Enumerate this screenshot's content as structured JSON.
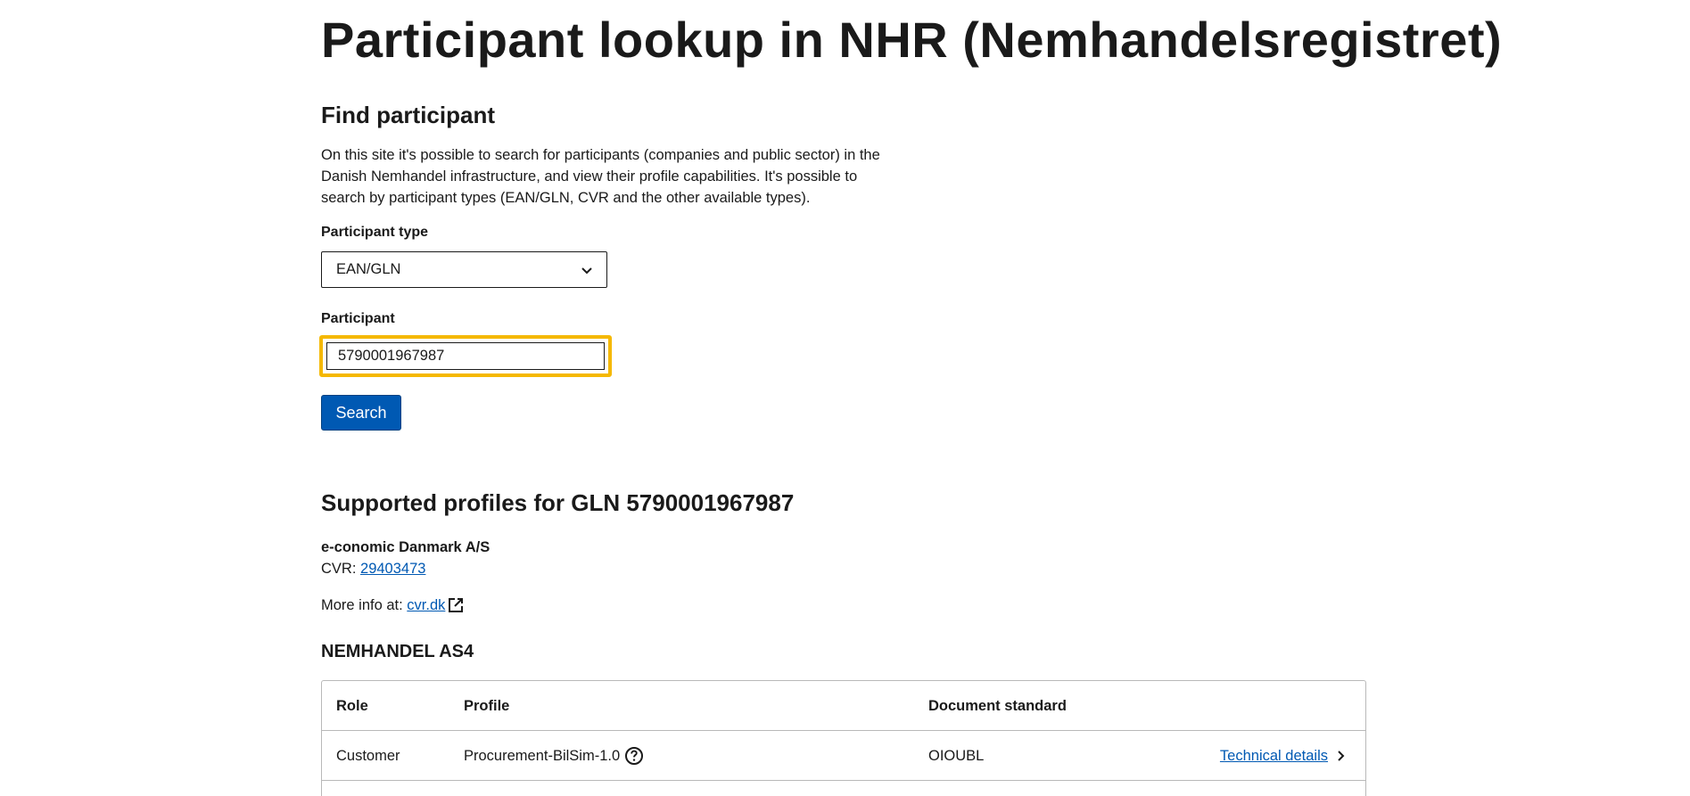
{
  "page": {
    "title": "Participant lookup in NHR (Nemhandelsregistret)"
  },
  "find": {
    "heading": "Find participant",
    "intro": "On this site it's possible to search for participants (companies and public sector) in the Danish Nemhandel infrastructure, and view their profile capabilities. It's possible to search by participant types (EAN/GLN, CVR and the other available types).",
    "type_label": "Participant type",
    "type_value": "EAN/GLN",
    "participant_label": "Participant",
    "participant_value": "5790001967987",
    "search_label": "Search"
  },
  "results": {
    "heading": "Supported profiles for GLN 5790001967987",
    "company": "e-conomic Danmark A/S",
    "cvr_label": "CVR: ",
    "cvr_value": "29403473",
    "more_info_label": "More info at: ",
    "more_info_link": "cvr.dk",
    "section_title": "NEMHANDEL AS4",
    "table": {
      "headers": [
        "Role",
        "Profile",
        "Document standard"
      ],
      "rows": [
        {
          "role": "Customer",
          "profile": "Procurement-BilSim-1.0",
          "standard": "OIOUBL",
          "details": "Technical details"
        }
      ]
    }
  },
  "colors": {
    "primary": "#0059b3",
    "focus": "#f5b800",
    "text": "#1a1a1a",
    "border": "#b9b9b9"
  },
  "icons": {
    "select": "chevron-down-icon",
    "external": "external-link-icon",
    "help": "question-circle-icon",
    "details": "chevron-right-icon"
  }
}
